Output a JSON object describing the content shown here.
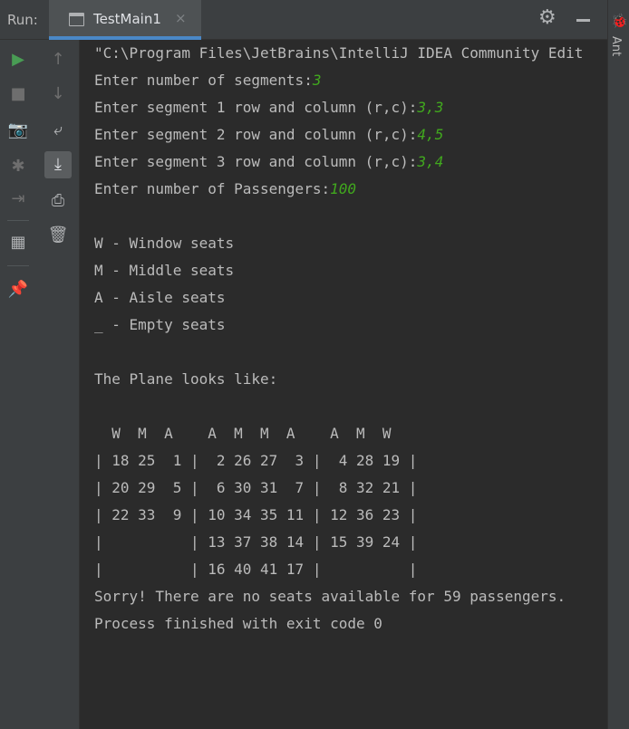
{
  "header": {
    "run_label": "Run:",
    "tab_title": "TestMain1",
    "tab_close": "×",
    "gear_glyph": "⚙",
    "ant_label": "Ant",
    "ant_glyph": "🐞"
  },
  "toolbar": {
    "rerun": "▶",
    "stop": "■",
    "camera": "📷",
    "debug": "✱",
    "exit": "⇥",
    "layout": "▦",
    "pin": "📌",
    "up": "↑",
    "down": "↓",
    "wrap": "⤶",
    "scroll_end": "⤓",
    "print": "⎙",
    "trash": "🗑",
    "colors": {
      "green": "#499c54",
      "blue": "#4a88c7",
      "gray": "#7a7e80"
    }
  },
  "console": {
    "lines": [
      {
        "text": "\"C:\\Program Files\\JetBrains\\IntelliJ IDEA Community Edit",
        "input": ""
      },
      {
        "text": "Enter number of segments:",
        "input": "3"
      },
      {
        "text": "Enter segment 1 row and column (r,c):",
        "input": "3,3"
      },
      {
        "text": "Enter segment 2 row and column (r,c):",
        "input": "4,5"
      },
      {
        "text": "Enter segment 3 row and column (r,c):",
        "input": "3,4"
      },
      {
        "text": "Enter number of Passengers:",
        "input": "100"
      },
      {
        "text": "",
        "input": ""
      },
      {
        "text": "W - Window seats",
        "input": ""
      },
      {
        "text": "M - Middle seats",
        "input": ""
      },
      {
        "text": "A - Aisle seats",
        "input": ""
      },
      {
        "text": "_ - Empty seats",
        "input": ""
      },
      {
        "text": "",
        "input": ""
      },
      {
        "text": "The Plane looks like:",
        "input": ""
      },
      {
        "text": "",
        "input": ""
      },
      {
        "text": "  W  M  A    A  M  M  A    A  M  W",
        "input": ""
      },
      {
        "text": "| 18 25  1 |  2 26 27  3 |  4 28 19 |",
        "input": ""
      },
      {
        "text": "| 20 29  5 |  6 30 31  7 |  8 32 21 |",
        "input": ""
      },
      {
        "text": "| 22 33  9 | 10 34 35 11 | 12 36 23 |",
        "input": ""
      },
      {
        "text": "|          | 13 37 38 14 | 15 39 24 |",
        "input": ""
      },
      {
        "text": "|          | 16 40 41 17 |          |",
        "input": ""
      },
      {
        "text": "Sorry! There are no seats available for 59 passengers.",
        "input": ""
      },
      {
        "text": "Process finished with exit code 0",
        "input": ""
      }
    ]
  }
}
